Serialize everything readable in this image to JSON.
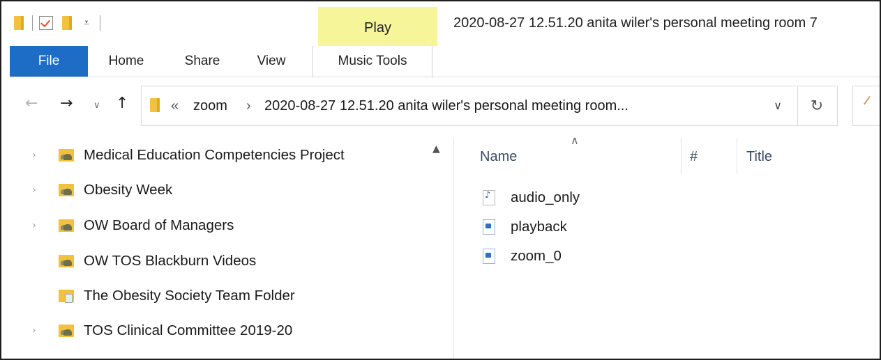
{
  "window": {
    "title": "2020-08-27 12.51.20 anita wiler's personal meeting room 7"
  },
  "ribbon": {
    "context_group": "Play",
    "tabs": [
      "File",
      "Home",
      "Share",
      "View",
      "Music Tools"
    ]
  },
  "address": {
    "overflow": "«",
    "crumbs": [
      "zoom",
      "2020-08-27 12.51.20 anita wiler's personal meeting room..."
    ],
    "separator": "›"
  },
  "nav_tree": [
    {
      "label": "Medical Education Competencies Project",
      "expandable": true,
      "icon": "shared-folder-icon"
    },
    {
      "label": "Obesity Week",
      "expandable": true,
      "icon": "shared-folder-icon"
    },
    {
      "label": "OW Board of Managers",
      "expandable": true,
      "icon": "shared-folder-icon"
    },
    {
      "label": "OW TOS Blackburn Videos",
      "expandable": false,
      "icon": "shared-folder-icon"
    },
    {
      "label": "The Obesity Society Team Folder",
      "expandable": false,
      "icon": "team-folder-icon"
    },
    {
      "label": "TOS Clinical Committee 2019-20",
      "expandable": true,
      "icon": "shared-folder-icon"
    }
  ],
  "file_list": {
    "columns": [
      "Name",
      "#",
      "Title"
    ],
    "files": [
      {
        "name": "audio_only",
        "icon": "audio-file-icon"
      },
      {
        "name": "playback",
        "icon": "video-file-icon"
      },
      {
        "name": "zoom_0",
        "icon": "video-file-icon"
      }
    ]
  }
}
